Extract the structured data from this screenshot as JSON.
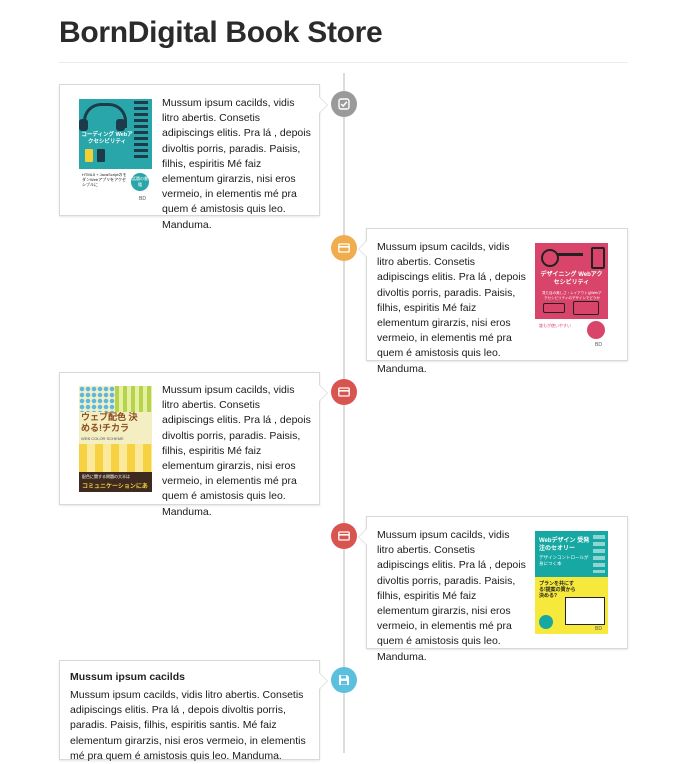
{
  "store": {
    "title": "BornDigital Book Store"
  },
  "colors": {
    "gray": "#9a9a9a",
    "orange": "#f0ad4e",
    "red": "#d9534f",
    "blue": "#5bc0de"
  },
  "entries": [
    {
      "side": "left",
      "marker_icon": "check-icon",
      "marker_color": "#9a9a9a",
      "text": "Mussum ipsum cacilds, vidis litro abertis. Consetis adipiscings elitis. Pra lá , depois divoltis porris, paradis. Paisis, filhis, espiritis Mé faiz elementum girarzis, nisi eros vermeio, in elementis mé pra quem é amistosis quis leo. Manduma.",
      "cover": {
        "title": "コーディング Webアクセシビリティ",
        "subtitle": "HTML5 + JavaScriptのモダンWebアプリをアクセシブルに",
        "badge": "話題の書籍",
        "publisher": "BD"
      }
    },
    {
      "side": "right",
      "marker_icon": "card-icon",
      "marker_color": "#f0ad4e",
      "text": "Mussum ipsum cacilds, vidis litro abertis. Consetis adipiscings elitis. Pra lá , depois divoltis porris, paradis. Paisis, filhis, espiritis Mé faiz elementum girarzis, nisi eros vermeio, in elementis mé pra quem é amistosis quis leo. Manduma.",
      "cover": {
        "title": "デザイニング Webアクセシビリティ",
        "subtitle": "見た目の美しさ・レイアウトはWebアクセシビリティのデザインでどうか",
        "badge": "誰もが使いやすい",
        "publisher": "BD"
      }
    },
    {
      "side": "left",
      "marker_icon": "card-icon",
      "marker_color": "#d9534f",
      "text": "Mussum ipsum cacilds, vidis litro abertis. Consetis adipiscings elitis. Pra lá , depois divoltis porris, paradis. Paisis, filhis, espiritis Mé faiz elementum girarzis, nisi eros vermeio, in elementis mé pra quem é amistosis quis leo. Manduma.",
      "cover": {
        "title": "ウェブ配色 決める!チカラ",
        "subtitle": "WEB COLOR SCHEME",
        "badge": "配色に関する問題の大半は",
        "footer": "コミュニケーションにある!"
      }
    },
    {
      "side": "right",
      "marker_icon": "card-icon",
      "marker_color": "#d9534f",
      "text": "Mussum ipsum cacilds, vidis litro abertis. Consetis adipiscings elitis. Pra lá , depois divoltis porris, paradis. Paisis, filhis, espiritis Mé faiz elementum girarzis, nisi eros vermeio, in elementis mé pra quem é amistosis quis leo. Manduma.",
      "cover": {
        "title": "Webデザイン 受発注のセオリー",
        "subtitle": "デザインコントロールが身につく本",
        "badge": "プランを共にする!提案の質から決める?",
        "publisher": "BD"
      }
    },
    {
      "side": "left",
      "marker_icon": "save-icon",
      "marker_color": "#5bc0de",
      "heading": "Mussum ipsum cacilds",
      "text": "Mussum ipsum cacilds, vidis litro abertis. Consetis adipiscings elitis. Pra lá , depois divoltis porris, paradis. Paisis, filhis, espiritis santis. Mé faiz elementum girarzis, nisi eros vermeio, in elementis mé pra quem é amistosis quis leo. Manduma."
    }
  ]
}
